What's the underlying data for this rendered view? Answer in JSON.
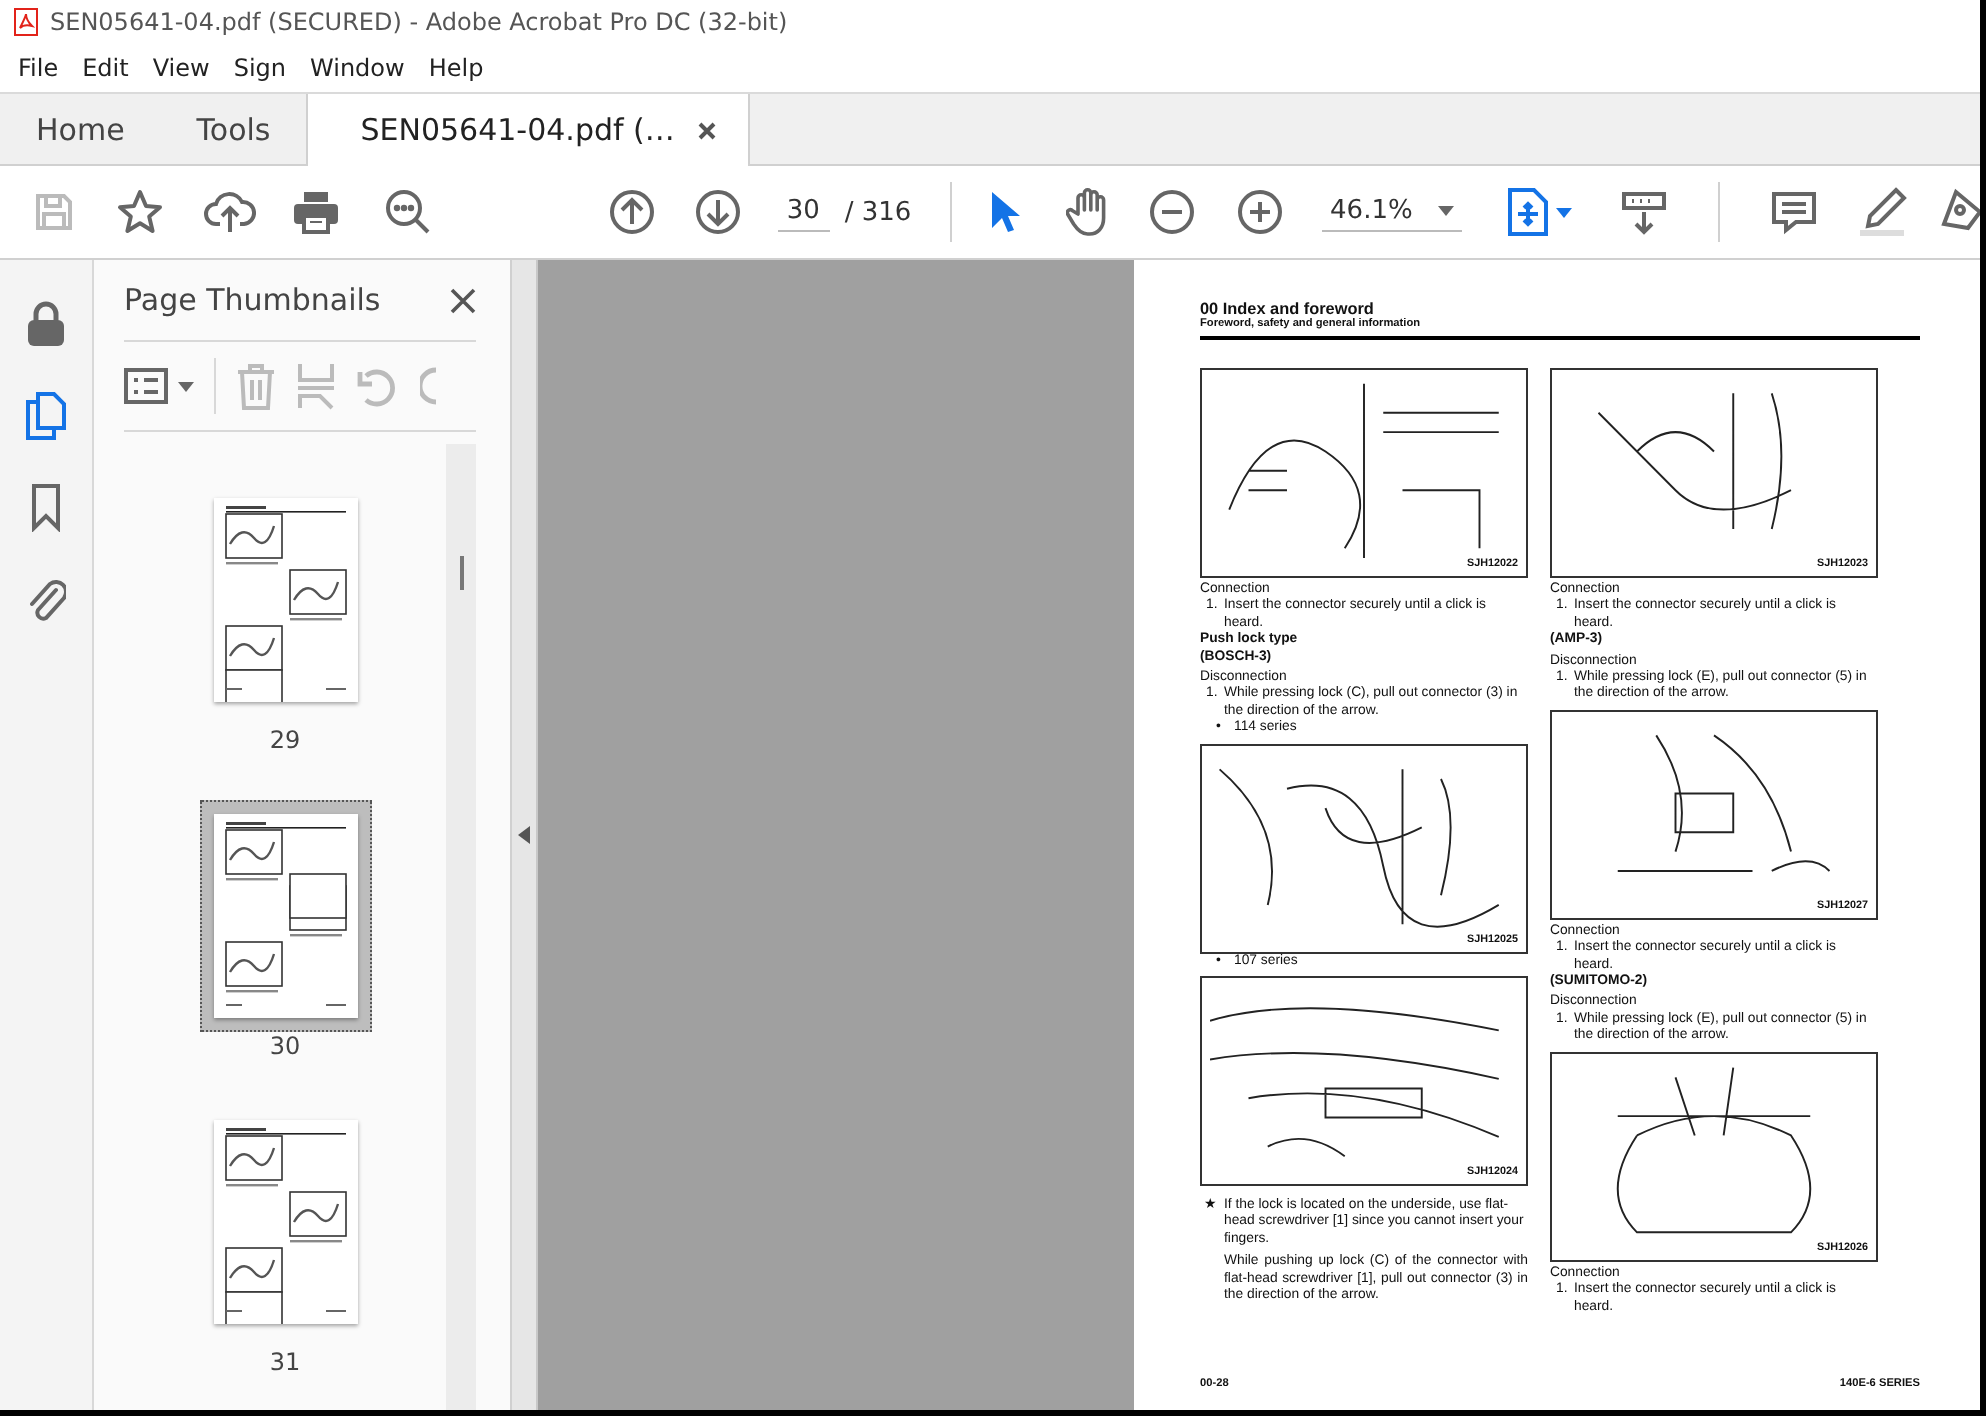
{
  "window": {
    "title": "SEN05641-04.pdf (SECURED) - Adobe Acrobat Pro DC (32-bit)"
  },
  "menu": [
    "File",
    "Edit",
    "View",
    "Sign",
    "Window",
    "Help"
  ],
  "tabs": [
    {
      "label": "Home",
      "selected": false
    },
    {
      "label": "Tools",
      "selected": false
    },
    {
      "label": "SEN05641-04.pdf (…",
      "selected": true
    }
  ],
  "toolbar": {
    "page_field": {
      "value": "30"
    },
    "page_total": "/ 316",
    "zoom_field": {
      "value": "46.1%"
    },
    "tools": [
      {
        "kind": "select",
        "selected": true
      },
      {
        "kind": "hand",
        "selected": false
      }
    ]
  },
  "rail": [
    {
      "kind": "lock",
      "selected": false
    },
    {
      "kind": "pages",
      "selected": true
    },
    {
      "kind": "bookmark",
      "selected": false
    },
    {
      "kind": "attachment",
      "selected": false
    }
  ],
  "thumbnail_panel": {
    "title": "Page Thumbnails",
    "thumbnails": [
      {
        "label": "29",
        "selected": false
      },
      {
        "label": "30",
        "selected": true
      },
      {
        "label": "31",
        "selected": false
      }
    ]
  },
  "document": {
    "title": "00 Index and foreword",
    "subtitle": "Foreword, safety and general information",
    "left_column": [
      {
        "kind": "figure",
        "code": "SJH12022"
      },
      {
        "kind": "label",
        "text": "Connection"
      },
      {
        "kind": "step",
        "number": "1.",
        "text": "Insert the connector securely until a click is heard."
      },
      {
        "kind": "heading",
        "text": "Push lock type"
      },
      {
        "kind": "heading",
        "text": "(BOSCH-3)"
      },
      {
        "kind": "label",
        "text": "Disconnection"
      },
      {
        "kind": "step",
        "number": "1.",
        "text": "While pressing lock (C), pull out connector (3) in the direction of the arrow."
      },
      {
        "kind": "bullet",
        "mark": "•",
        "text": "114 series"
      },
      {
        "kind": "figure",
        "code": "SJH12025"
      },
      {
        "kind": "bullet",
        "mark": "•",
        "text": "107 series"
      },
      {
        "kind": "figure",
        "code": "SJH12024"
      },
      {
        "kind": "note",
        "mark": "★",
        "text": "If the lock is located on the underside, use flat-head screwdriver [1] since you cannot insert your fingers."
      },
      {
        "kind": "paragraph",
        "text": "While pushing up lock (C) of the connector with flat-head screwdriver [1], pull out connector (3) in the direction of the arrow."
      }
    ],
    "right_column": [
      {
        "kind": "figure",
        "code": "SJH12023"
      },
      {
        "kind": "label",
        "text": "Connection"
      },
      {
        "kind": "step",
        "number": "1.",
        "text": "Insert the connector securely until a click is heard."
      },
      {
        "kind": "heading",
        "text": "(AMP-3)"
      },
      {
        "kind": "label",
        "text": "Disconnection"
      },
      {
        "kind": "step",
        "number": "1.",
        "text": "While pressing lock (E), pull out connector (5) in the direction of the arrow."
      },
      {
        "kind": "figure",
        "code": "SJH12027"
      },
      {
        "kind": "label",
        "text": "Connection"
      },
      {
        "kind": "step",
        "number": "1.",
        "text": "Insert the connector securely until a click is heard."
      },
      {
        "kind": "heading",
        "text": "(SUMITOMO-2)"
      },
      {
        "kind": "label",
        "text": "Disconnection"
      },
      {
        "kind": "step",
        "number": "1.",
        "text": "While pressing lock (E), pull out connector (5) in the direction of the arrow."
      },
      {
        "kind": "figure",
        "code": "SJH12026"
      },
      {
        "kind": "label",
        "text": "Connection"
      },
      {
        "kind": "step",
        "number": "1.",
        "text": "Insert the connector securely until a click is heard."
      }
    ],
    "footer_left": "00-28",
    "footer_right": "140E-6 SERIES"
  }
}
